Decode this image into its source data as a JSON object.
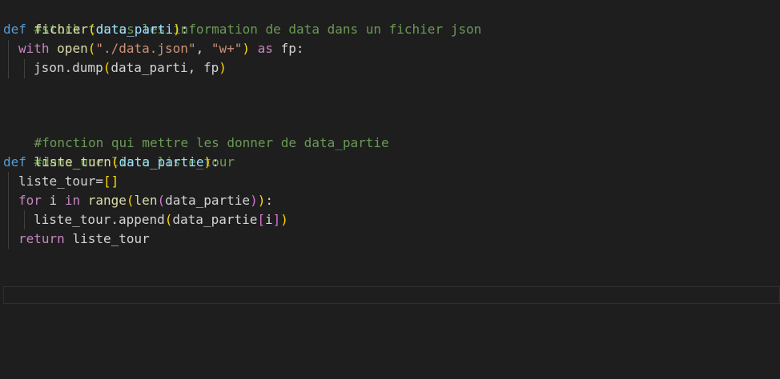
{
  "theme": {
    "background": "#1e1e1e",
    "comment": "#6a9955",
    "keyword": "#569cd6",
    "control": "#c586c0",
    "function": "#dcdcaa",
    "parameter": "#9cdcfe",
    "string": "#ce9178",
    "bracket_1": "#ffd700",
    "bracket_2": "#da70d6",
    "bracket_3": "#179fff",
    "text": "#d4d4d4"
  },
  "code": {
    "l1": {
      "comment": "#stock toutes les information de data dans un fichier json"
    },
    "l2": {
      "def": "def",
      "name": "fichier",
      "open": "(",
      "param": "data_parti",
      "close": ")",
      "colon": ":"
    },
    "l3": {
      "with": "with",
      "fn": "open",
      "open": "(",
      "str1": "\"./data.json\"",
      "comma": ", ",
      "str2": "\"w+\"",
      "close": ")",
      "as": "as",
      "var": "fp:"
    },
    "l4": {
      "call": "json.dump",
      "open": "(",
      "args": "data_parti, fp",
      "close": ")"
    },
    "l7": {
      "comment": "#fonction qui mettre les donner de data_partie"
    },
    "l8": {
      "comment": "#dans une liste liste_tour"
    },
    "l9": {
      "def": "def",
      "name": "liste_turn",
      "open": "(",
      "param": "data_partie",
      "close": ")",
      "colon": ":"
    },
    "l10": {
      "assign": "liste_tour=",
      "brackets": "[]"
    },
    "l11": {
      "for": "for",
      "var": "i",
      "in": "in",
      "range": "range",
      "p1": "(",
      "len": "len",
      "p2": "(",
      "arg": "data_partie",
      "p2c": ")",
      "p1c": ")",
      "colon": ":"
    },
    "l12": {
      "call": "liste_tour.append",
      "open": "(",
      "arg": "data_partie",
      "sq_open": "[",
      "idx": "i",
      "sq_close": "]",
      "close": ")"
    },
    "l13": {
      "ret": "return",
      "var": "liste_tour"
    }
  }
}
